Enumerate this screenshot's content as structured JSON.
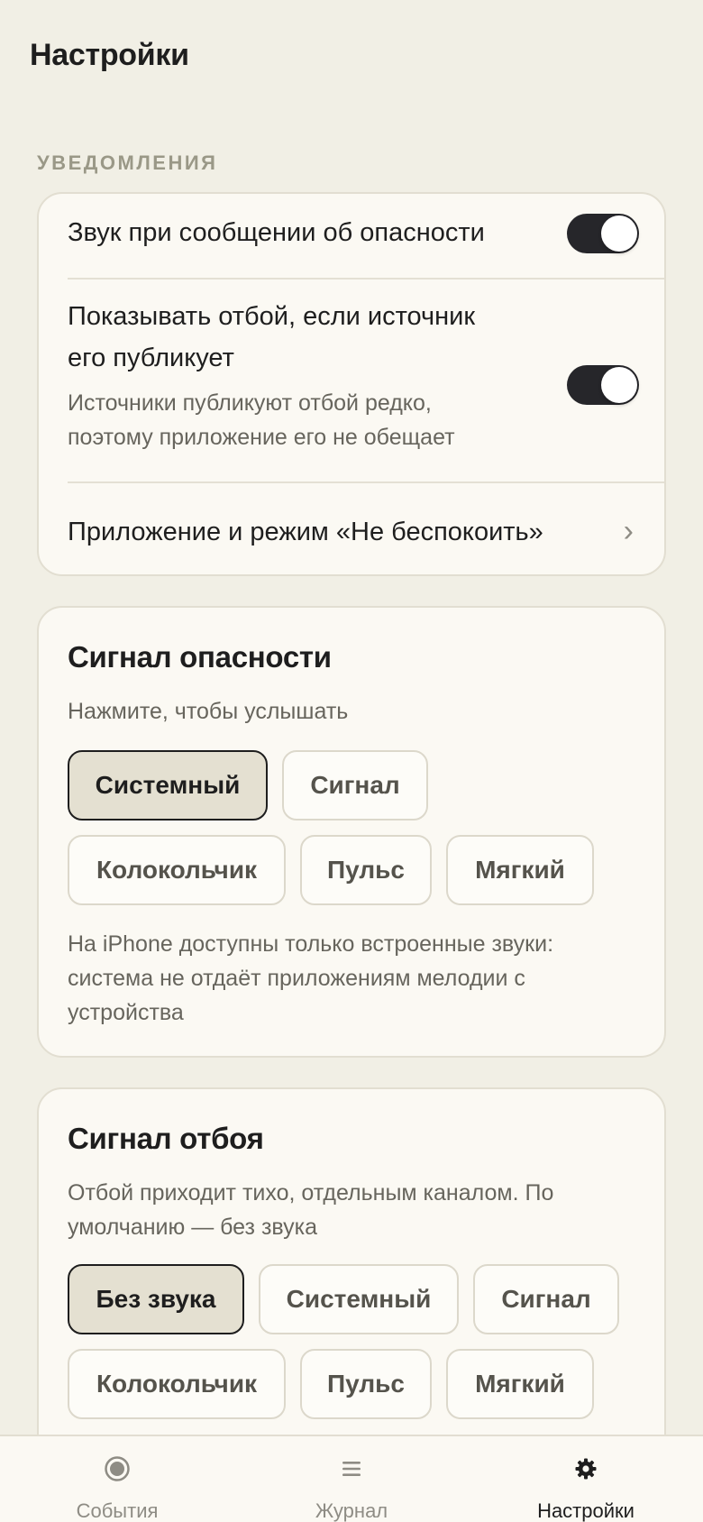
{
  "header": {
    "title": "Настройки"
  },
  "notifications": {
    "section_label": "УВЕДОМЛЕНИЯ",
    "danger_sound": {
      "label": "Звук при сообщении об опасности",
      "enabled": true
    },
    "show_all_clear": {
      "label_line1": "Показывать отбой, если источник",
      "label_line2": "его публикует",
      "sub_line1": "Источники публикуют отбой редко,",
      "sub_line2": "поэтому приложение его не обещает",
      "enabled": true
    },
    "dnd_link": {
      "label": "Приложение и режим «Не беспокоить»",
      "chevron": "›"
    }
  },
  "danger_signal": {
    "title": "Сигнал опасности",
    "subtitle": "Нажмите, чтобы услышать",
    "options": [
      "Системный",
      "Сигнал",
      "Колокольчик",
      "Пульс",
      "Мягкий"
    ],
    "selected": "Системный",
    "note_line1": "На iPhone доступны только встроенные звуки:",
    "note_line2": "система не отдаёт приложениям мелодии с",
    "note_line3": "устройства"
  },
  "all_clear_signal": {
    "title": "Сигнал отбоя",
    "subtitle_line1": "Отбой приходит тихо, отдельным каналом. По",
    "subtitle_line2": "умолчанию — без звука",
    "options": [
      "Без звука",
      "Системный",
      "Сигнал",
      "Колокольчик",
      "Пульс",
      "Мягкий"
    ],
    "selected": "Без звука"
  },
  "tabbar": {
    "tabs": [
      {
        "label": "События",
        "icon": "radio-dot-icon"
      },
      {
        "label": "Журнал",
        "icon": "list-icon"
      },
      {
        "label": "Настройки",
        "icon": "gear-icon"
      }
    ],
    "active": "Настройки"
  },
  "colors": {
    "background": "#f1efe5",
    "card": "#fbf9f3",
    "toggle_on": "#26262a",
    "chip_selected": "#e4e0d1"
  }
}
